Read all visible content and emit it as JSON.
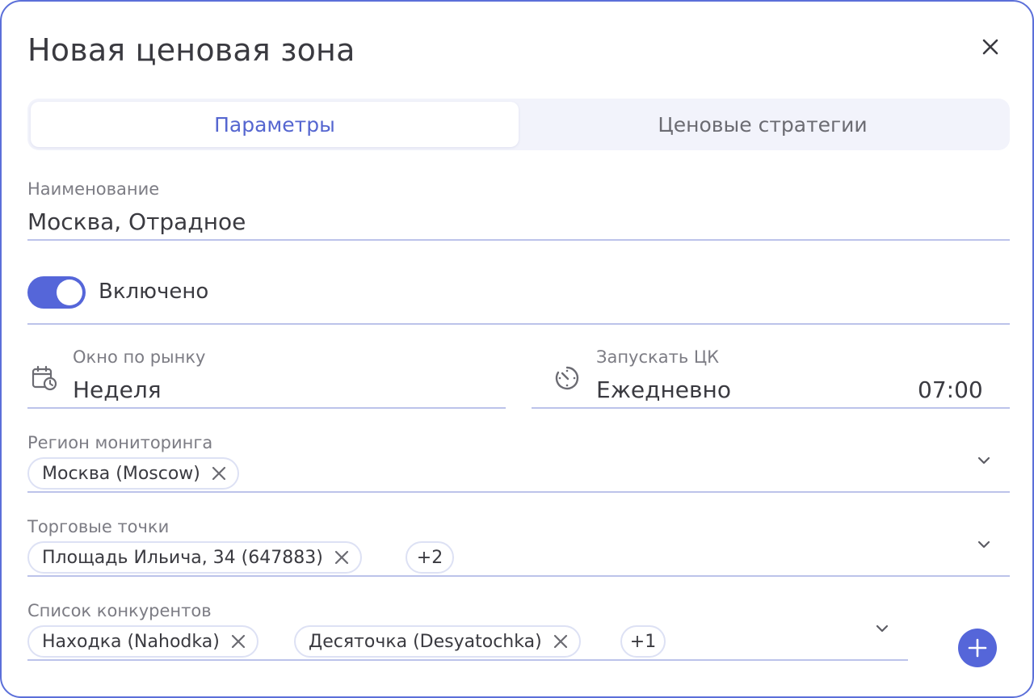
{
  "dialog": {
    "title": "Новая ценовая зона"
  },
  "tabs": [
    {
      "label": "Параметры",
      "active": true
    },
    {
      "label": "Ценовые стратегии",
      "active": false
    }
  ],
  "name_field": {
    "label": "Наименование",
    "value": "Москва, Отрадное"
  },
  "toggle": {
    "label": "Включено",
    "on": true
  },
  "market_window": {
    "label": "Окно по рынку",
    "value": "Неделя",
    "icon": "calendar-clock-icon"
  },
  "run_schedule": {
    "label": "Запускать ЦК",
    "value": "Ежедневно",
    "time": "07:00",
    "icon": "timer-icon"
  },
  "region": {
    "label": "Регион мониторинга",
    "chips": [
      "Москва (Moscow)"
    ]
  },
  "stores": {
    "label": "Торговые точки",
    "chips": [
      "Площадь Ильича, 34 (647883)"
    ],
    "more": "+2"
  },
  "competitors": {
    "label": "Список конкурентов",
    "chips": [
      "Находка (Nahodka)",
      "Десяточка (Desyatochka)"
    ],
    "more": "+1"
  },
  "colors": {
    "accent": "#5566d9",
    "border": "#5b6fd9",
    "underline": "#bcc3ea",
    "tab_bg": "#f2f3fb"
  }
}
